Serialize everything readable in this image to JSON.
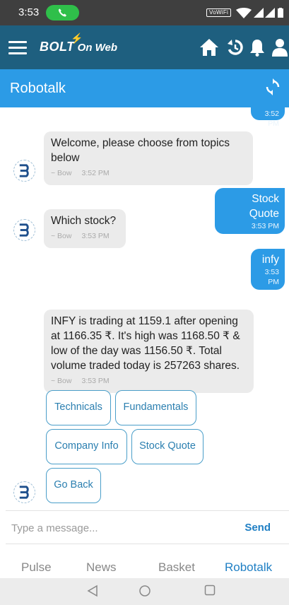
{
  "status_bar": {
    "time": "3:53",
    "wifi_label": "VoWiFi"
  },
  "header": {
    "brand": "BOLT",
    "brand_suffix": "On Web",
    "icons": [
      "menu-icon",
      "home-icon",
      "history-icon",
      "bell-icon",
      "user-icon"
    ]
  },
  "titlebar": {
    "title": "Robotalk",
    "icon": "refresh-icon"
  },
  "chat": {
    "partial_user_time": "3:52 PM",
    "messages": [
      {
        "from": "bot",
        "text": "Welcome, please choose from topics below",
        "sender": "~ Bow",
        "time": "3:52 PM"
      },
      {
        "from": "user",
        "text": "Stock Quote",
        "time": "3:53 PM"
      },
      {
        "from": "bot",
        "text": "Which stock?",
        "sender": "~ Bow",
        "time": "3:53 PM"
      },
      {
        "from": "user",
        "text": "infy",
        "time": "3:53 PM"
      },
      {
        "from": "bot",
        "text": "INFY is trading at 1159.1 after opening at 1166.35 ₹. It's high was 1168.50 ₹ & low of the day was 1156.50 ₹. Total volume traded today is 257263 shares.",
        "sender": "~ Bow",
        "time": "3:53 PM"
      }
    ],
    "quick_replies": [
      "Technicals",
      "Fundamentals",
      "Company Info",
      "Stock Quote",
      "Go Back"
    ]
  },
  "composer": {
    "placeholder": "Type a message...",
    "send_label": "Send"
  },
  "tabs": [
    {
      "label": "Pulse",
      "active": false
    },
    {
      "label": "News",
      "active": false
    },
    {
      "label": "Basket",
      "active": false
    },
    {
      "label": "Robotalk",
      "active": true
    }
  ],
  "colors": {
    "appbar": "#1e5f7f",
    "titlebar": "#2c9be6",
    "user_bubble": "#2c9be6",
    "bot_bubble": "#ebebeb",
    "accent": "#1f7fc4"
  }
}
